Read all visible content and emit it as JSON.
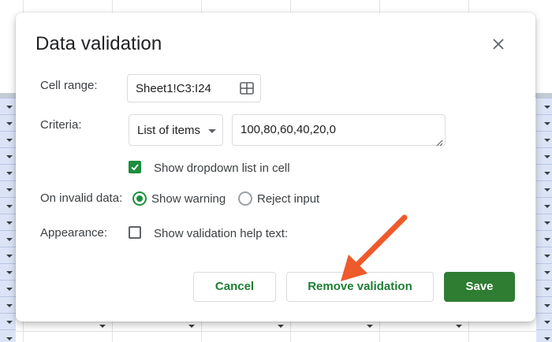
{
  "dialog": {
    "title": "Data validation",
    "close_icon": "close-icon"
  },
  "cell_range": {
    "label": "Cell range:",
    "value": "Sheet1!C3:I24",
    "icon": "grid-select-icon"
  },
  "criteria": {
    "label": "Criteria:",
    "type_selected": "List of items",
    "items_value": "100,80,60,40,20,0"
  },
  "show_dropdown": {
    "label": "Show dropdown list in cell",
    "checked": true
  },
  "invalid_data": {
    "label": "On invalid data:",
    "options": [
      {
        "label": "Show warning",
        "selected": true
      },
      {
        "label": "Reject input",
        "selected": false
      }
    ]
  },
  "appearance": {
    "label": "Appearance:",
    "help_text_label": "Show validation help text:",
    "checked": false
  },
  "buttons": {
    "cancel": "Cancel",
    "remove": "Remove validation",
    "save": "Save"
  },
  "colors": {
    "accent_green": "#2e7d32",
    "annotation_arrow": "#ee5a2b"
  }
}
